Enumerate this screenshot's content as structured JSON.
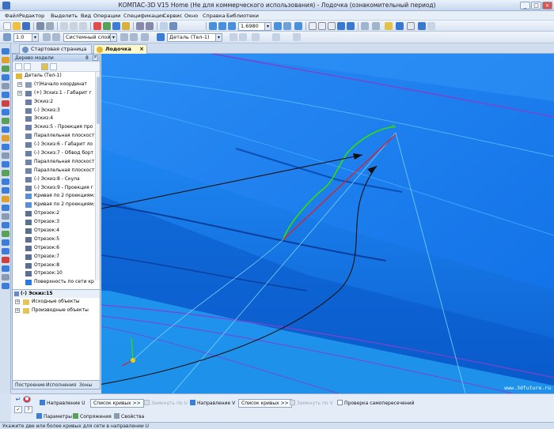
{
  "window": {
    "title": "КОМПАС-3D V15 Home (Не для коммерческого использования) - Лодочка (ознакомительный период)"
  },
  "menu": [
    "Файл",
    "Редактор",
    "Выделить",
    "Вид",
    "Операции",
    "Спецификация",
    "Сервис",
    "Окно",
    "Справка",
    "Библиотеки"
  ],
  "toolbar": {
    "zoom_value": "1.6980",
    "scale_value": "1.0",
    "layer_value": "Системный слой (0)",
    "part_value": "Деталь (Тел-1)"
  },
  "tabs": [
    {
      "label": "Стартовая страница",
      "active": false
    },
    {
      "label": "Лодочка",
      "active": true,
      "close": "×"
    }
  ],
  "tree": {
    "panel_title": "Дерево модели",
    "panel_number": "8",
    "root": "Деталь (Тел-1)",
    "items": [
      "(т)Начало координат",
      "(+) Эскиз:1 - Габарит г",
      "Эскиз:2",
      "(-) Эскиз:3",
      "Эскиз:4",
      "Эскиз:5 - Проекция про",
      "Параллельная плоскост",
      "(-) Эскиз:6 - Габарит ло",
      "(-) Эскиз:7 - Обвод борт",
      "Параллельная плоскост",
      "Параллельная плоскост",
      "(-) Эскиз:8 - Скула",
      "(-) Эскиз:9 - Проекция г",
      "Кривая по 2 проекциям:",
      "Кривая по 2 проекциям:",
      "Отрезок:2",
      "Отрезок:3",
      "Отрезок:4",
      "Отрезок:5",
      "Отрезок:6",
      "Отрезок:7",
      "Отрезок:8",
      "Отрезок:10",
      "Поверхность по сети кр"
    ],
    "sketch_title": "(-) Эскиз:15",
    "sketch_items": [
      "Исходные объекты",
      "Производные объекты"
    ],
    "panel_tabs": [
      "Построение",
      "Исполнения",
      "Зоны"
    ]
  },
  "viewport": {
    "watermark": "www.3dfuture.ru",
    "point_label": "A"
  },
  "properties": {
    "dir_u_label": "Направление U",
    "curves_u_button": "Список кривых",
    "curves_u_arrow": ">>",
    "tangency_u": "Замкнуть по U",
    "dir_v_label": "Направление V",
    "curves_v_button": "Список кривых",
    "curves_v_arrow": ">>",
    "tangency_v": "Замкнуть по V",
    "self_intersect": "Проверка самопересечений",
    "tab_params": "Параметры",
    "tab_mates": "Сопряжения",
    "tab_props": "Свойства"
  },
  "status": "Укажите две или более кривых для сети в направлении U",
  "colors": {
    "viewport_blue": "#1c7ff0",
    "curve_green": "#35e000",
    "curve_red": "#e02020",
    "arrow_black": "#111111"
  }
}
